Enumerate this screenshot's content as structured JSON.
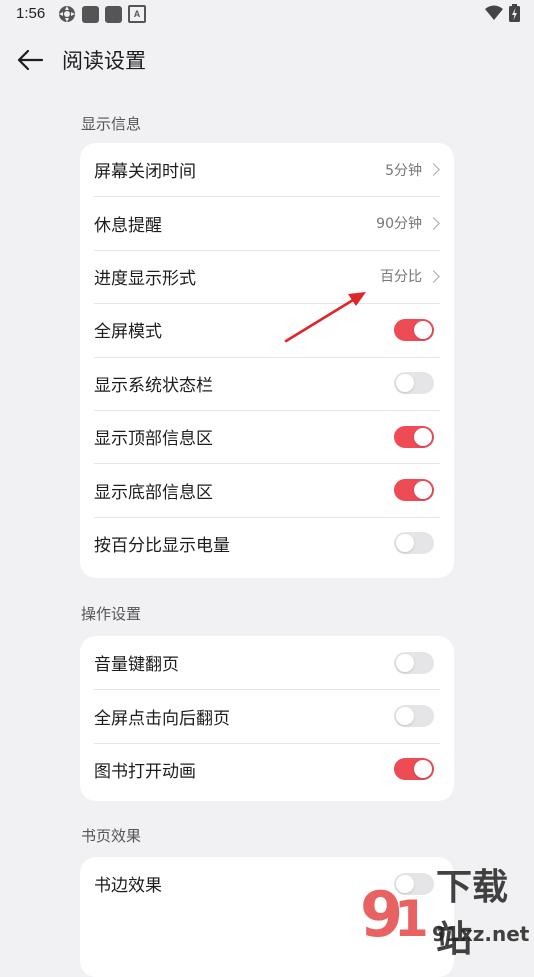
{
  "status_bar": {
    "time": "1:56"
  },
  "header": {
    "title": "阅读设置"
  },
  "sections": [
    {
      "label": "显示信息",
      "rows": [
        {
          "label": "屏幕关闭时间",
          "type": "nav",
          "value": "5分钟"
        },
        {
          "label": "休息提醒",
          "type": "nav",
          "value": "90分钟"
        },
        {
          "label": "进度显示形式",
          "type": "nav",
          "value": "百分比"
        },
        {
          "label": "全屏模式",
          "type": "toggle",
          "on": true
        },
        {
          "label": "显示系统状态栏",
          "type": "toggle",
          "on": false
        },
        {
          "label": "显示顶部信息区",
          "type": "toggle",
          "on": true
        },
        {
          "label": "显示底部信息区",
          "type": "toggle",
          "on": true
        },
        {
          "label": "按百分比显示电量",
          "type": "toggle",
          "on": false
        }
      ]
    },
    {
      "label": "操作设置",
      "rows": [
        {
          "label": "音量键翻页",
          "type": "toggle",
          "on": false
        },
        {
          "label": "全屏点击向后翻页",
          "type": "toggle",
          "on": false
        },
        {
          "label": "图书打开动画",
          "type": "toggle",
          "on": true
        }
      ]
    },
    {
      "label": "书页效果",
      "rows": [
        {
          "label": "书边效果",
          "type": "toggle",
          "on": false
        }
      ]
    }
  ],
  "watermark": {
    "brand_text": "下载站",
    "site_text": "91xz.net"
  },
  "colors": {
    "accent": "#ee4b55",
    "background": "#f1f1f3",
    "card": "#ffffff"
  }
}
